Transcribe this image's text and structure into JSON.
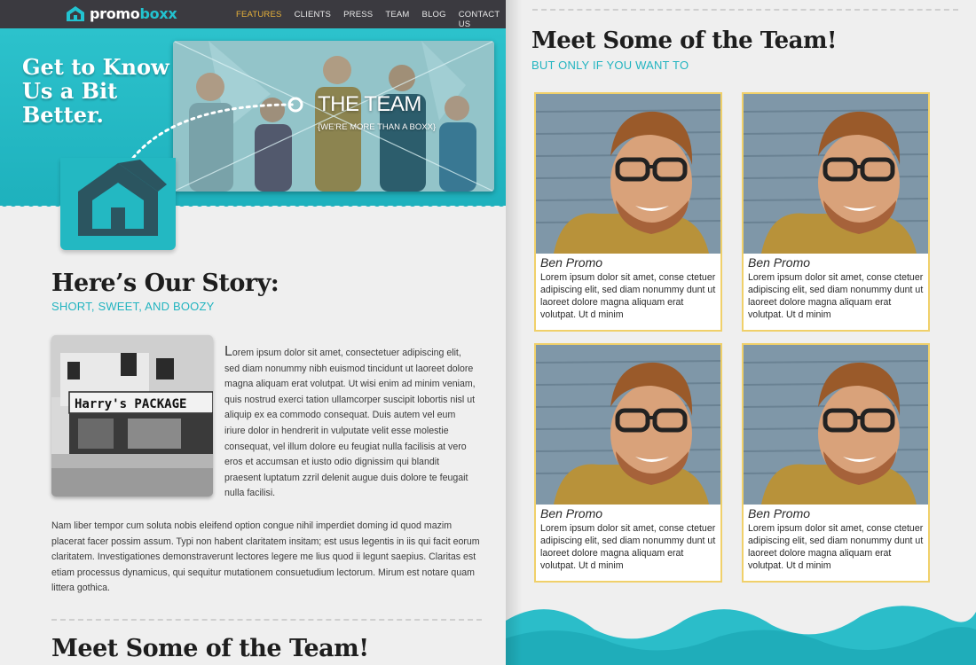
{
  "brand": {
    "logo_part1": "promo",
    "logo_part2": "boxx"
  },
  "nav": {
    "items": [
      "FEATURES",
      "CLIENTS",
      "PRESS",
      "TEAM",
      "BLOG",
      "CONTACT US"
    ]
  },
  "hero": {
    "title_lines": [
      "Get to Know",
      "Us a Bit",
      "Better."
    ],
    "photo_title": "THE TEAM",
    "photo_subtitle": "{WE'RE MORE THAN A BOXX}"
  },
  "story": {
    "title": "Here’s Our Story:",
    "subtitle": "SHORT, SWEET, AND BOOZY",
    "store_sign": "Harry's PACKAGE",
    "para1_dropcap": "L",
    "para1": "orem ipsum dolor sit amet, consectetuer adipiscing elit, sed diam nonummy nibh euismod tincidunt ut laoreet dolore magna aliquam erat volutpat. Ut wisi enim ad minim veniam, quis nostrud exerci tation ullamcorper suscipit lobortis nisl ut aliquip ex ea commodo consequat. Duis autem vel eum iriure dolor in hendrerit in vulputate velit esse molestie consequat, vel illum dolore eu feugiat nulla facilisis at vero eros et accumsan et iusto odio dignissim qui blandit praesent luptatum zzril delenit augue duis dolore te feugait nulla facilisi.",
    "para2": "Nam liber tempor cum soluta nobis eleifend option congue nihil imperdiet doming id quod mazim placerat facer possim assum. Typi non habent claritatem insitam; est usus legentis in iis qui facit eorum claritatem. Investigationes demonstraverunt lectores legere me lius quod ii legunt saepius. Claritas est etiam processus dynamicus, qui sequitur mutationem consuetudium lectorum. Mirum est notare quam littera gothica."
  },
  "team": {
    "title": "Meet Some of the Team!",
    "subtitle": "BUT ONLY IF YOU WANT TO",
    "members": [
      {
        "name": "Ben Promo",
        "bio": "Lorem ipsum dolor sit amet, conse ctetuer adipiscing elit, sed diam nonummy dunt ut laoreet dolore magna aliquam erat volutpat. Ut d minim"
      },
      {
        "name": "Ben Promo",
        "bio": "Lorem ipsum dolor sit amet, conse ctetuer adipiscing elit, sed diam nonummy dunt ut laoreet dolore magna aliquam erat volutpat. Ut d minim"
      },
      {
        "name": "Ben Promo",
        "bio": "Lorem ipsum dolor sit amet, conse ctetuer adipiscing elit, sed diam nonummy dunt ut laoreet dolore magna aliquam erat volutpat. Ut d minim"
      },
      {
        "name": "Ben Promo",
        "bio": "Lorem ipsum dolor sit amet, conse ctetuer adipiscing elit, sed diam nonummy dunt ut laoreet dolore magna aliquam erat volutpat. Ut d minim"
      }
    ]
  },
  "colors": {
    "accent": "#22b4c0",
    "nav_bg": "#3b3a40",
    "active_nav": "#e8b23a",
    "card_border": "#f0d06a"
  }
}
